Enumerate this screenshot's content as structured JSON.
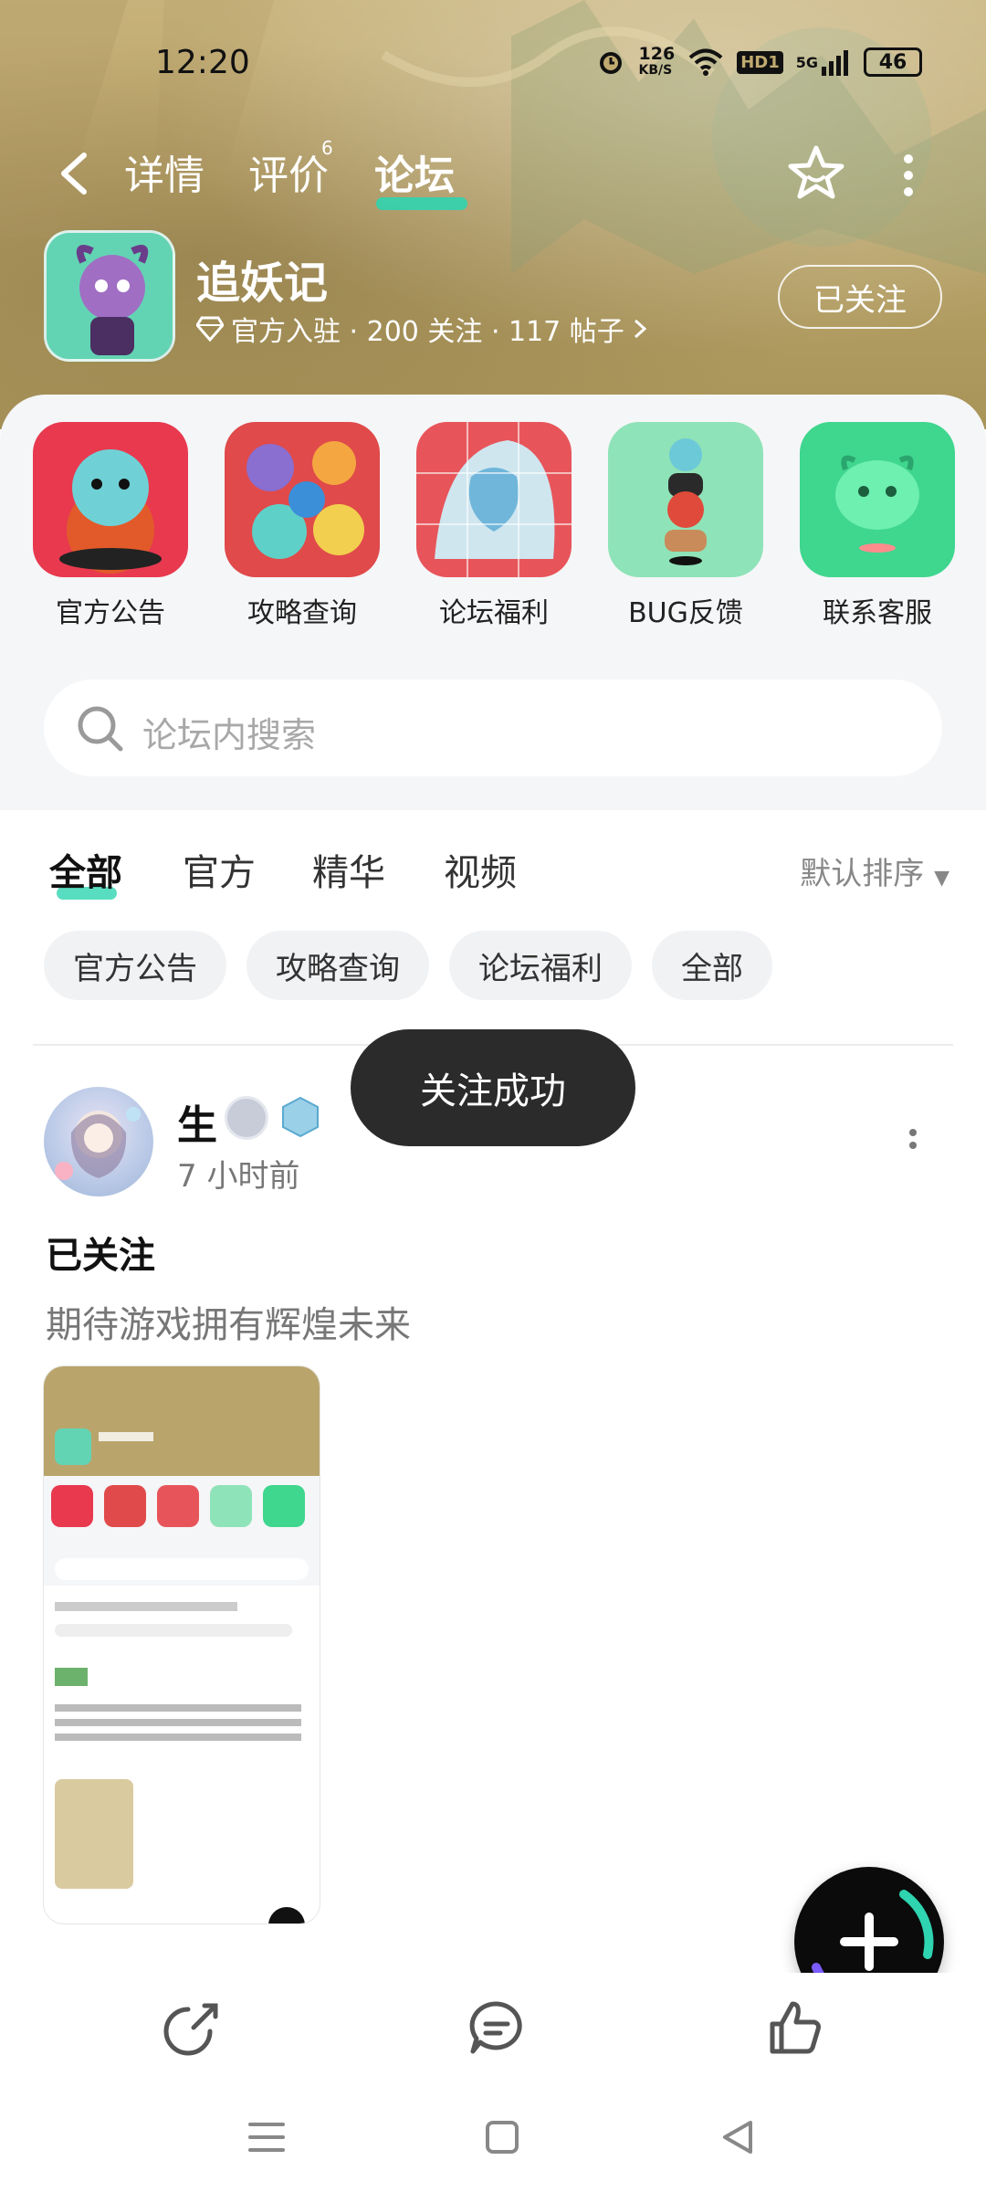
{
  "status_bar": {
    "time": "12:20",
    "net_speed_value": "126",
    "net_speed_unit": "KB/S",
    "hd_label": "HD1",
    "network": "5G",
    "battery": "46",
    "icons": [
      "alarm-icon",
      "wifi-icon",
      "signal-icon",
      "battery-icon"
    ]
  },
  "top_nav": {
    "tabs": [
      {
        "label": "详情"
      },
      {
        "label": "评价",
        "badge": "6"
      },
      {
        "label": "论坛",
        "active": true
      }
    ]
  },
  "app": {
    "name": "追妖记",
    "meta": "官方入驻 · 200 关注 · 117 帖子",
    "follow_label": "已关注"
  },
  "shortcuts": [
    {
      "label": "官方公告",
      "icon": "official-notice-icon"
    },
    {
      "label": "攻略查询",
      "icon": "guide-icon"
    },
    {
      "label": "论坛福利",
      "icon": "welfare-icon"
    },
    {
      "label": "BUG反馈",
      "icon": "bug-feedback-icon"
    },
    {
      "label": "联系客服",
      "icon": "customer-service-icon"
    }
  ],
  "search": {
    "placeholder": "论坛内搜索"
  },
  "feed_tabs": [
    {
      "label": "全部",
      "active": true
    },
    {
      "label": "官方"
    },
    {
      "label": "精华"
    },
    {
      "label": "视频"
    }
  ],
  "sort_label": "默认排序",
  "chips": [
    "官方公告",
    "攻略查询",
    "论坛福利",
    "全部"
  ],
  "post": {
    "author": "生",
    "time": "7 小时前",
    "title": "已关注",
    "body": "期待游戏拥有辉煌未来"
  },
  "toast": "关注成功",
  "colors": {
    "accent": "#2fd4b0",
    "banner": "#bca66b",
    "sheet": "#f5f6f8",
    "toast_bg": "#2b2b2b"
  }
}
